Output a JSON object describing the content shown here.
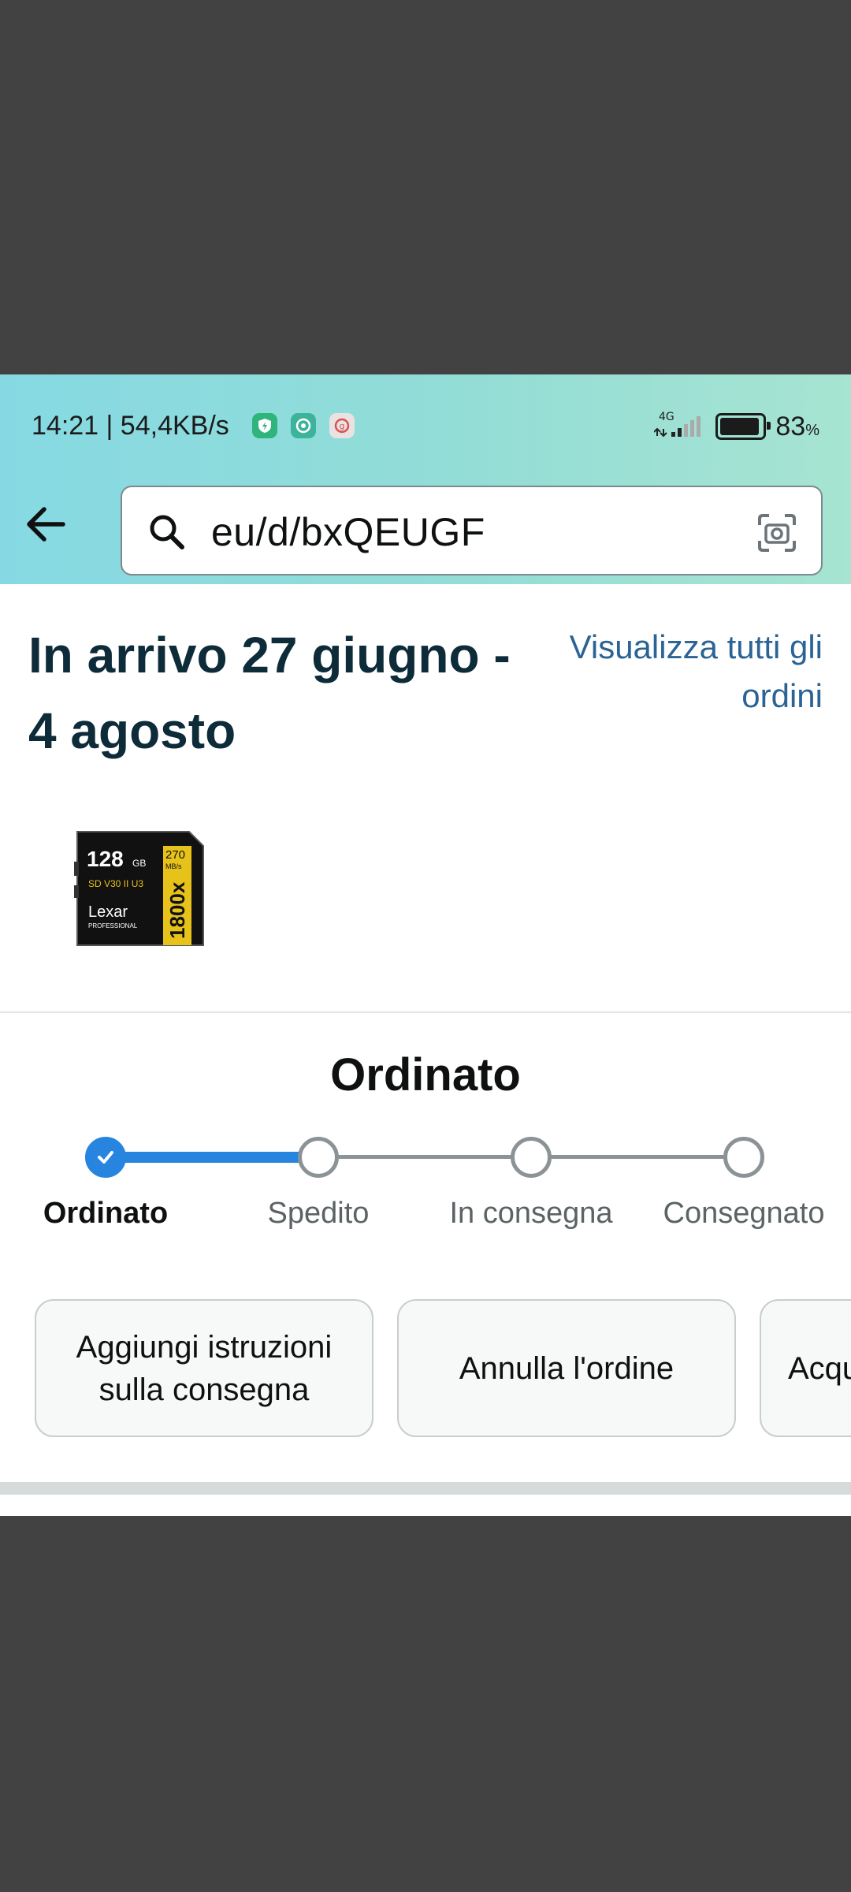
{
  "status_bar": {
    "time_speed": "14:21 | 54,4KB/s",
    "network": "4G",
    "battery_pct": "83",
    "battery_unit": "%",
    "battery_level": 0.83,
    "notification_icons": [
      "shield-bolt-icon",
      "chat-app-icon",
      "mail-app-icon"
    ]
  },
  "search": {
    "query": "eu/d/bxQEUGF"
  },
  "order": {
    "delivery_title": "In arrivo 27 giugno - 4 agosto",
    "view_all_orders": "Visualizza tutti gli ordini",
    "product_image_text": [
      "128",
      "GB",
      "270",
      "MB/s",
      "Lexar",
      "PROFESSIONAL",
      "1800x"
    ],
    "status_heading": "Ordinato",
    "progress_fraction": 0.333,
    "steps": [
      {
        "label": "Ordinato",
        "done": true
      },
      {
        "label": "Spedito",
        "done": false
      },
      {
        "label": "In consegna",
        "done": false
      },
      {
        "label": "Consegnato",
        "done": false
      }
    ],
    "actions": [
      {
        "label": "Aggiungi istruzioni sulla consegna"
      },
      {
        "label": "Annulla l'ordine"
      },
      {
        "label": "Acqu"
      }
    ]
  },
  "colors": {
    "accent_blue": "#2785e0",
    "link_blue": "#2a6395",
    "title_dark": "#0d2b38"
  }
}
